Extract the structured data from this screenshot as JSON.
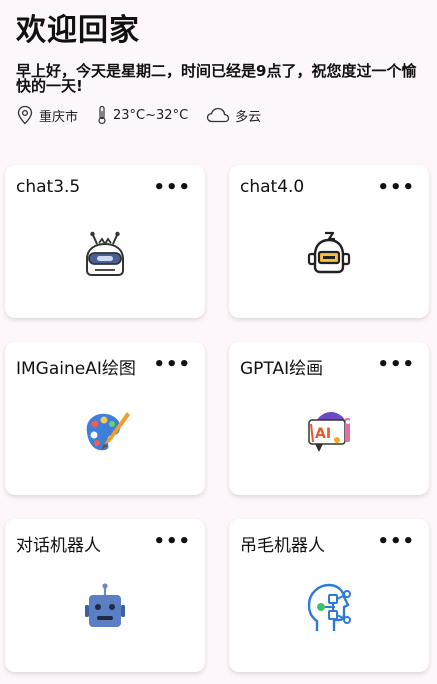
{
  "header": {
    "title": "欢迎回家",
    "greeting": "早上好，今天是星期二，时间已经是9点了，祝您度过一个愉快的一天!",
    "location": "重庆市",
    "temperature": "23°C~32°C",
    "weather": "多云"
  },
  "cards": [
    {
      "title": "chat3.5",
      "more": "•••",
      "icon": "robot-head-icon"
    },
    {
      "title": "chat4.0",
      "more": "•••",
      "icon": "robot-yellow-icon"
    },
    {
      "title": "IMGaineAI绘图",
      "more": "•••",
      "icon": "paint-palette-icon"
    },
    {
      "title": "GPTAI绘画",
      "more": "•••",
      "icon": "ai-drawing-icon"
    },
    {
      "title": "对话机器人",
      "more": "•••",
      "icon": "chat-robot-icon"
    },
    {
      "title": "吊毛机器人",
      "more": "•••",
      "icon": "ai-brain-icon"
    }
  ]
}
